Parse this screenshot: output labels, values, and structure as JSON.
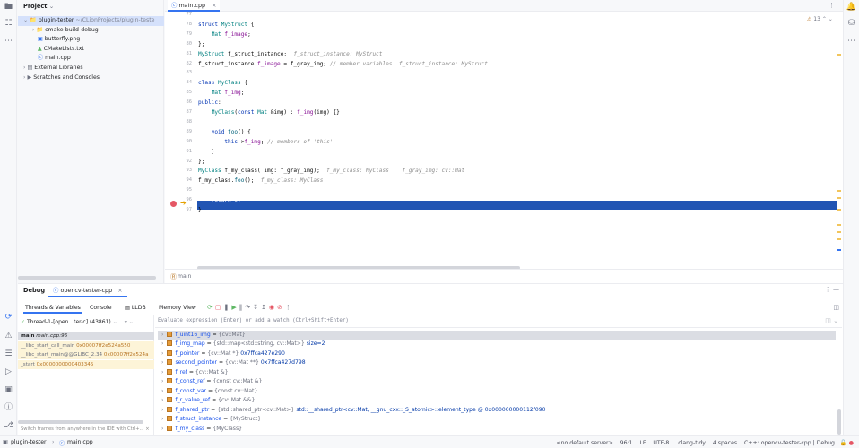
{
  "left_strip": {
    "icons": [
      "folder-icon",
      "structure-icon",
      "more-icon"
    ],
    "bottom_icons": [
      "debug-icon",
      "warning-icon",
      "todo-icon",
      "services-icon",
      "terminal-icon",
      "problems-icon",
      "git-icon"
    ]
  },
  "project": {
    "title": "Project",
    "items": [
      {
        "label": "plugin-tester",
        "extra": "~/CLionProjects/plugin-teste",
        "kind": "folder",
        "indent": 0,
        "open": true,
        "selected": true
      },
      {
        "label": "cmake-build-debug",
        "extra": "",
        "kind": "folder",
        "indent": 1,
        "open": false,
        "selected": false
      },
      {
        "label": "butterfly.png",
        "extra": "",
        "kind": "image",
        "indent": 1,
        "open": null,
        "selected": false
      },
      {
        "label": "CMakeLists.txt",
        "extra": "",
        "kind": "cmake",
        "indent": 1,
        "open": null,
        "selected": false
      },
      {
        "label": "main.cpp",
        "extra": "",
        "kind": "cpp",
        "indent": 1,
        "open": null,
        "selected": false
      },
      {
        "label": "External Libraries",
        "extra": "",
        "kind": "lib",
        "indent": 0,
        "open": false,
        "selected": false
      },
      {
        "label": "Scratches and Consoles",
        "extra": "",
        "kind": "scratch",
        "indent": 0,
        "open": false,
        "selected": false
      }
    ]
  },
  "editor": {
    "tab": "main.cpp",
    "warnings": "13",
    "breadcrumb": "main",
    "lines": [
      {
        "n": "77",
        "t": ""
      },
      {
        "n": "78",
        "t": "struct MyStruct {"
      },
      {
        "n": "79",
        "t": "    Mat f_image;"
      },
      {
        "n": "80",
        "t": "};"
      },
      {
        "n": "81",
        "t": "MyStruct f_struct_instance;",
        "hint": "f_struct_instance: MyStruct"
      },
      {
        "n": "82",
        "t": "f_struct_instance.f_image = f_gray_img;",
        "cm": "// member variables",
        "hint": "f_struct_instance: MyStruct"
      },
      {
        "n": "83",
        "t": ""
      },
      {
        "n": "84",
        "t": "class MyClass {"
      },
      {
        "n": "85",
        "t": "    Mat f_img;"
      },
      {
        "n": "86",
        "t": "public:"
      },
      {
        "n": "87",
        "t": "    MyClass(const Mat &img) : f_img(img) {}"
      },
      {
        "n": "88",
        "t": ""
      },
      {
        "n": "89",
        "t": "    void foo() {"
      },
      {
        "n": "90",
        "t": "        this->f_img;",
        "cm": "// members of 'this'"
      },
      {
        "n": "91",
        "t": "    }"
      },
      {
        "n": "92",
        "t": "};"
      },
      {
        "n": "93",
        "t": "MyClass f_my_class( img: f_gray_img);",
        "hint": "f_my_class: MyClass    f_gray_img: cv::Mat"
      },
      {
        "n": "94",
        "t": "f_my_class.foo();",
        "hint": "f_my_class: MyClass"
      },
      {
        "n": "95",
        "t": ""
      },
      {
        "n": "96",
        "t": "    return 0;",
        "current": true
      },
      {
        "n": "97",
        "t": "}"
      }
    ]
  },
  "debug": {
    "title": "Debug",
    "config_tab": "opencv-tester-cpp",
    "tabs": [
      "Threads & Variables",
      "Console",
      "LLDB",
      "Memory View"
    ],
    "thread": "Thread-1-[open...ter-c] (43861)",
    "frames": [
      {
        "name": "main",
        "loc": "main.cpp:96",
        "addr": ""
      },
      {
        "name": "__libc_start_call_main",
        "loc": "",
        "addr": "0x00007ff2e524a550"
      },
      {
        "name": "__libc_start_main@@GLIBC_2.34",
        "loc": "",
        "addr": "0x00007ff2e524a"
      },
      {
        "name": "_start",
        "loc": "",
        "addr": "0x0000000000403345"
      }
    ],
    "switch_hint": "Switch frames from anywhere in the IDE with Ctrl+...",
    "eval_placeholder": "Evaluate expression (Enter) or add a watch (Ctrl+Shift+Enter)",
    "vars": [
      {
        "name": "f_uint16_img",
        "type": "{cv::Mat}",
        "value": ""
      },
      {
        "name": "f_img_map",
        "type": "{std::map<std::string, cv::Mat>}",
        "value": "size=2"
      },
      {
        "name": "f_pointer",
        "type": "{cv::Mat *}",
        "value": "0x7ffca427e290"
      },
      {
        "name": "second_pointer",
        "type": "{cv::Mat **}",
        "value": "0x7ffca427d798"
      },
      {
        "name": "f_ref",
        "type": "{cv::Mat &}",
        "value": ""
      },
      {
        "name": "f_const_ref",
        "type": "{const cv::Mat &}",
        "value": ""
      },
      {
        "name": "f_const_var",
        "type": "{const cv::Mat}",
        "value": ""
      },
      {
        "name": "f_r_value_ref",
        "type": "{cv::Mat &&}",
        "value": ""
      },
      {
        "name": "f_shared_ptr",
        "type": "{std::shared_ptr<cv::Mat>}",
        "value": "std::__shared_ptr<cv::Mat, __gnu_cxx::_S_atomic>::element_type @ 0x000000000112f090"
      },
      {
        "name": "f_struct_instance",
        "type": "{MyStruct}",
        "value": ""
      },
      {
        "name": "f_my_class",
        "type": "{MyClass}",
        "value": ""
      }
    ]
  },
  "status": {
    "crumb1": "plugin-tester",
    "crumb2": "main.cpp",
    "server": "<no default server>",
    "pos": "96:1",
    "le": "LF",
    "enc": "UTF-8",
    "tidy": ".clang-tidy",
    "indent": "4 spaces",
    "ctx": "C++: opencv-tester-cpp | Debug"
  }
}
